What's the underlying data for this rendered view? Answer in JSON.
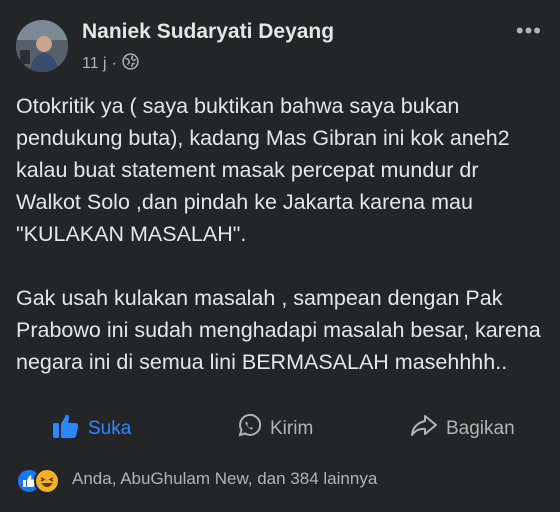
{
  "post": {
    "author": "Naniek Sudaryati Deyang",
    "time": "11 j",
    "separator": "·",
    "privacy_icon": "globe-icon",
    "more_icon": "more-options-icon",
    "more_label": "•••",
    "paragraphs": [
      "Otokritik ya ( saya buktikan  bahwa saya bukan pendukung buta), kadang Mas Gibran ini kok aneh2  kalau buat statement  masak percepat mundur dr Walkot Solo ,dan pindah ke Jakarta karena mau \"KULAKAN MASALAH\".",
      "Gak usah kulakan masalah , sampean dengan Pak Prabowo ini sudah menghadapi masalah besar, karena negara ini di semua lini BERMASALAH masehhhh.."
    ]
  },
  "actions": {
    "like_label": "Suka",
    "send_label": "Kirim",
    "share_label": "Bagikan"
  },
  "reactions": {
    "summary": "Anda, AbuGhulam New, dan 384 lainnya",
    "icons": [
      "like-reaction-icon",
      "haha-reaction-icon"
    ]
  },
  "colors": {
    "background": "#242526",
    "text": "#e4e6eb",
    "secondary_text": "#b0b3b8",
    "like_active": "#2d88ff"
  }
}
